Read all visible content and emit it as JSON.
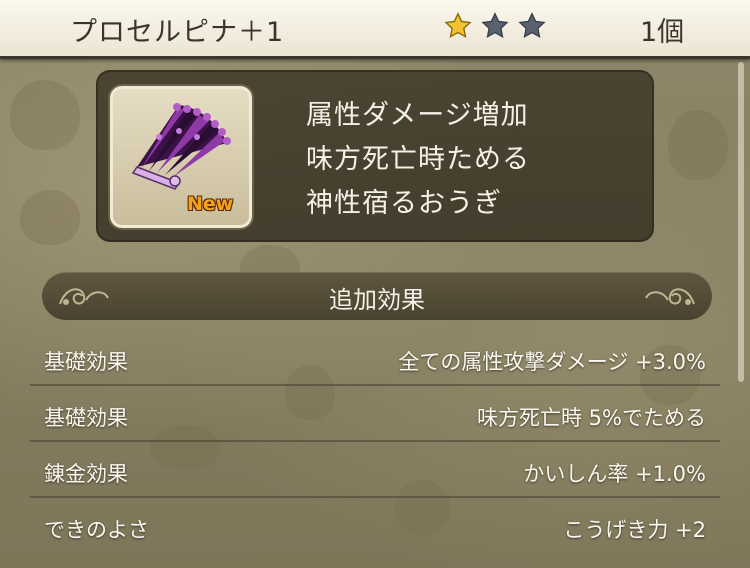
{
  "header": {
    "item_name": "プロセルピナ＋1",
    "rating": {
      "filled": 1,
      "total": 3
    },
    "quantity": "1個"
  },
  "item_card": {
    "icon": "purple-fan-icon",
    "new_badge": "New",
    "description_lines": [
      "属性ダメージ増加",
      "味方死亡時ためる",
      "神性宿るおうぎ"
    ]
  },
  "effects_section": {
    "title": "追加効果",
    "rows": [
      {
        "label": "基礎効果",
        "value": "全ての属性攻撃ダメージ +3.0%"
      },
      {
        "label": "基礎効果",
        "value": "味方死亡時 5%でためる"
      },
      {
        "label": "錬金効果",
        "value": "かいしん率 +1.0%"
      },
      {
        "label": "できのよさ",
        "value": "こうげき力 +2"
      }
    ]
  },
  "colors": {
    "star_gold": "#f2c230",
    "star_empty": "#5a6270",
    "new_badge": "#f4a21c",
    "fan_purple": "#7b2d8e"
  }
}
